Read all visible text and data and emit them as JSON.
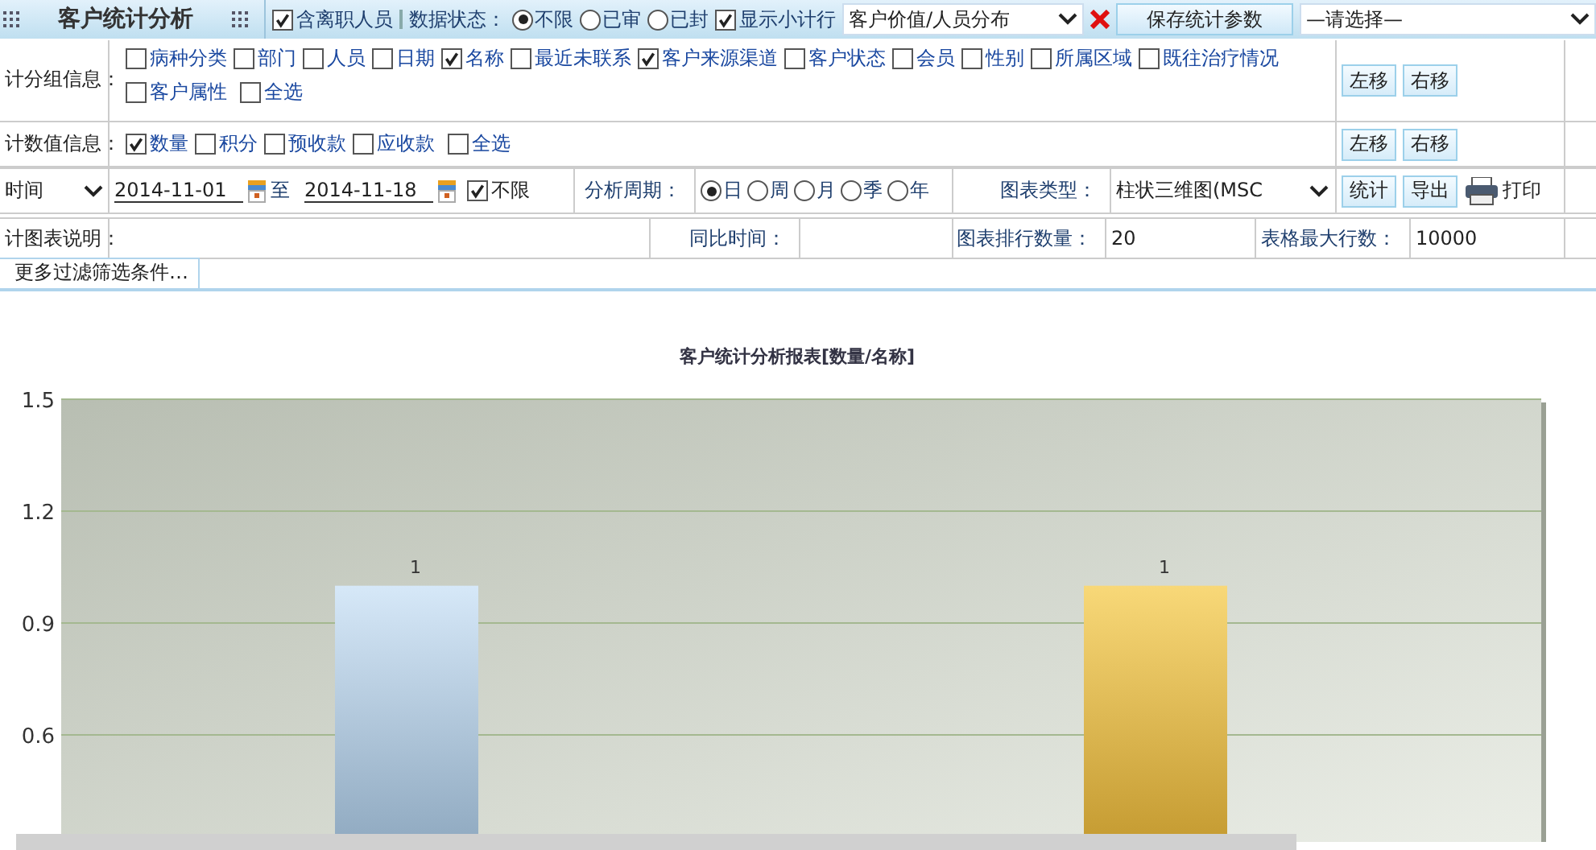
{
  "header": {
    "title": "客户统计分析",
    "include_resigned": {
      "label": "含离职人员",
      "checked": true
    },
    "status_label": "数据状态：",
    "status_options": [
      {
        "label": "不限",
        "selected": true
      },
      {
        "label": "已审",
        "selected": false
      },
      {
        "label": "已封",
        "selected": false
      }
    ],
    "show_subtotal": {
      "label": "显示小计行",
      "checked": true
    },
    "template_select": "客户价值/人员分布",
    "save_button": "保存统计参数",
    "choose_select": "—请选择—"
  },
  "group_info": {
    "label": "计分组信息：",
    "options": [
      {
        "label": "病种分类",
        "checked": false
      },
      {
        "label": "部门",
        "checked": false
      },
      {
        "label": "人员",
        "checked": false
      },
      {
        "label": "日期",
        "checked": false
      },
      {
        "label": "名称",
        "checked": true
      },
      {
        "label": "最近未联系",
        "checked": false
      },
      {
        "label": "客户来源渠道",
        "checked": true
      },
      {
        "label": "客户状态",
        "checked": false
      },
      {
        "label": "会员",
        "checked": false
      },
      {
        "label": "性别",
        "checked": false
      },
      {
        "label": "所属区域",
        "checked": false
      },
      {
        "label": "既往治疗情况",
        "checked": false
      },
      {
        "label": "客户属性",
        "checked": false
      }
    ],
    "select_all": {
      "label": "全选",
      "checked": false
    },
    "left_button": "左移",
    "right_button": "右移"
  },
  "value_info": {
    "label": "计数值信息：",
    "options": [
      {
        "label": "数量",
        "checked": true
      },
      {
        "label": "积分",
        "checked": false
      },
      {
        "label": "预收款",
        "checked": false
      },
      {
        "label": "应收款",
        "checked": false
      }
    ],
    "select_all": {
      "label": "全选",
      "checked": false
    },
    "left_button": "左移",
    "right_button": "右移"
  },
  "time_row": {
    "field_select": "时间",
    "start": "2014-11-01",
    "to": "至",
    "end": "2014-11-18",
    "unlimited": {
      "label": "不限",
      "checked": true
    },
    "period_label": "分析周期：",
    "periods": [
      {
        "label": "日",
        "selected": true
      },
      {
        "label": "周",
        "selected": false
      },
      {
        "label": "月",
        "selected": false
      },
      {
        "label": "季",
        "selected": false
      },
      {
        "label": "年",
        "selected": false
      }
    ],
    "chart_type_label": "图表类型：",
    "chart_type": "柱状三维图(MSC",
    "stat_button": "统计",
    "export_button": "导出",
    "print_button": "打印"
  },
  "desc_row": {
    "label": "计图表说明：",
    "yoy_label": "同比时间：",
    "rank_label": "图表排行数量：",
    "rank_value": "20",
    "max_rows_label": "表格最大行数：",
    "max_rows_value": "10000"
  },
  "more_filters": "更多过滤筛选条件…",
  "chart": {
    "chart_data": {
      "type": "bar",
      "title": "客户统计分析报表[数量/名称]",
      "values": [
        1,
        1
      ],
      "ylim": [
        0.3,
        1.5
      ],
      "yticks": [
        0.6,
        0.9,
        1.2,
        1.5
      ],
      "data_labels": true,
      "grid": true
    }
  }
}
